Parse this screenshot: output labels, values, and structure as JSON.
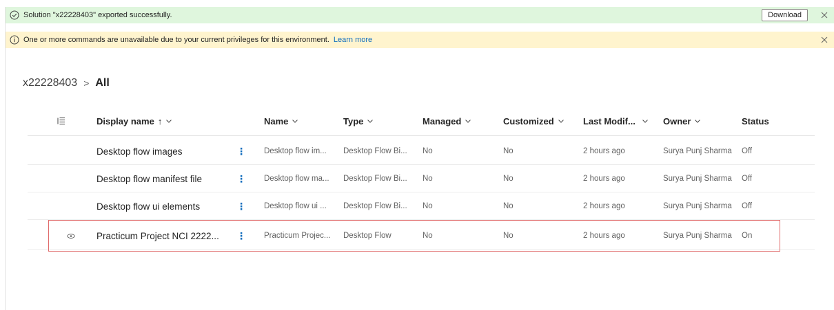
{
  "banners": {
    "success": {
      "icon": "check-circle-icon",
      "text": "Solution \"x22228403\" exported successfully.",
      "download_label": "Download",
      "color": "#dff6dd"
    },
    "warning": {
      "icon": "info-icon",
      "text": "One or more commands are unavailable due to your current privileges for this environment.",
      "link_label": "Learn more",
      "color": "#fff4ce"
    }
  },
  "breadcrumb": {
    "root": "x22228403",
    "separator": ">",
    "current": "All"
  },
  "table": {
    "headers": {
      "display_name": "Display name",
      "sort_indicator": "↑",
      "name": "Name",
      "type": "Type",
      "managed": "Managed",
      "customized": "Customized",
      "last_modified": "Last Modif...",
      "owner": "Owner",
      "status": "Status"
    },
    "rows": [
      {
        "display_name": "Desktop flow images",
        "name": "Desktop flow im...",
        "type": "Desktop Flow Bi...",
        "managed": "No",
        "customized": "No",
        "last_modified": "2 hours ago",
        "owner": "Surya Punj Sharma",
        "status": "Off",
        "icon": ""
      },
      {
        "display_name": "Desktop flow manifest file",
        "name": "Desktop flow ma...",
        "type": "Desktop Flow Bi...",
        "managed": "No",
        "customized": "No",
        "last_modified": "2 hours ago",
        "owner": "Surya Punj Sharma",
        "status": "Off",
        "icon": ""
      },
      {
        "display_name": "Desktop flow ui elements",
        "name": "Desktop flow ui ...",
        "type": "Desktop Flow Bi...",
        "managed": "No",
        "customized": "No",
        "last_modified": "2 hours ago",
        "owner": "Surya Punj Sharma",
        "status": "Off",
        "icon": ""
      },
      {
        "display_name": "Practicum Project NCI 2222...",
        "name": "Practicum Projec...",
        "type": "Desktop Flow",
        "managed": "No",
        "customized": "No",
        "last_modified": "2 hours ago",
        "owner": "Surya Punj Sharma",
        "status": "On",
        "icon": "desktop-flow-icon"
      }
    ],
    "highlighted_row": 3,
    "highlight_color": "#e06a6a"
  },
  "colors": {
    "link": "#0f6cbd",
    "text": "#242424",
    "muted": "#616161"
  }
}
